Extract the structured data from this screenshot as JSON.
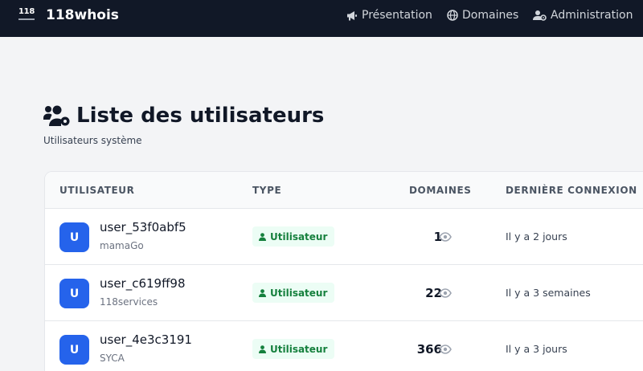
{
  "navbar": {
    "logo_text": "118",
    "brand": "118whois",
    "items": [
      {
        "label": "Présentation",
        "icon": "megaphone-icon"
      },
      {
        "label": "Domaines",
        "icon": "globe-icon"
      },
      {
        "label": "Administration",
        "icon": "user-cog-icon"
      }
    ]
  },
  "page": {
    "title": "Liste des utilisateurs",
    "title_icon": "users-cog-icon",
    "subtitle": "Utilisateurs système"
  },
  "table": {
    "headers": [
      "UTILISATEUR",
      "TYPE",
      "DOMAINES",
      "DERNIÈRE CONNEXION"
    ],
    "rows": [
      {
        "avatar": "U",
        "username": "user_53f0abf5",
        "company": "mamaGo",
        "type": "Utilisateur",
        "domains": "1",
        "last_login": "Il y a 2 jours"
      },
      {
        "avatar": "U",
        "username": "user_c619ff98",
        "company": "118services",
        "type": "Utilisateur",
        "domains": "22",
        "last_login": "Il y a 3 semaines"
      },
      {
        "avatar": "U",
        "username": "user_4e3c3191",
        "company": "SYCA",
        "type": "Utilisateur",
        "domains": "366",
        "last_login": "Il y a 3 jours"
      }
    ]
  },
  "colors": {
    "navbar_bg": "#111827",
    "avatar_bg": "#2563eb",
    "badge_bg": "#ecfdf5",
    "badge_text": "#15803d",
    "page_bg": "#f3f4f6"
  }
}
